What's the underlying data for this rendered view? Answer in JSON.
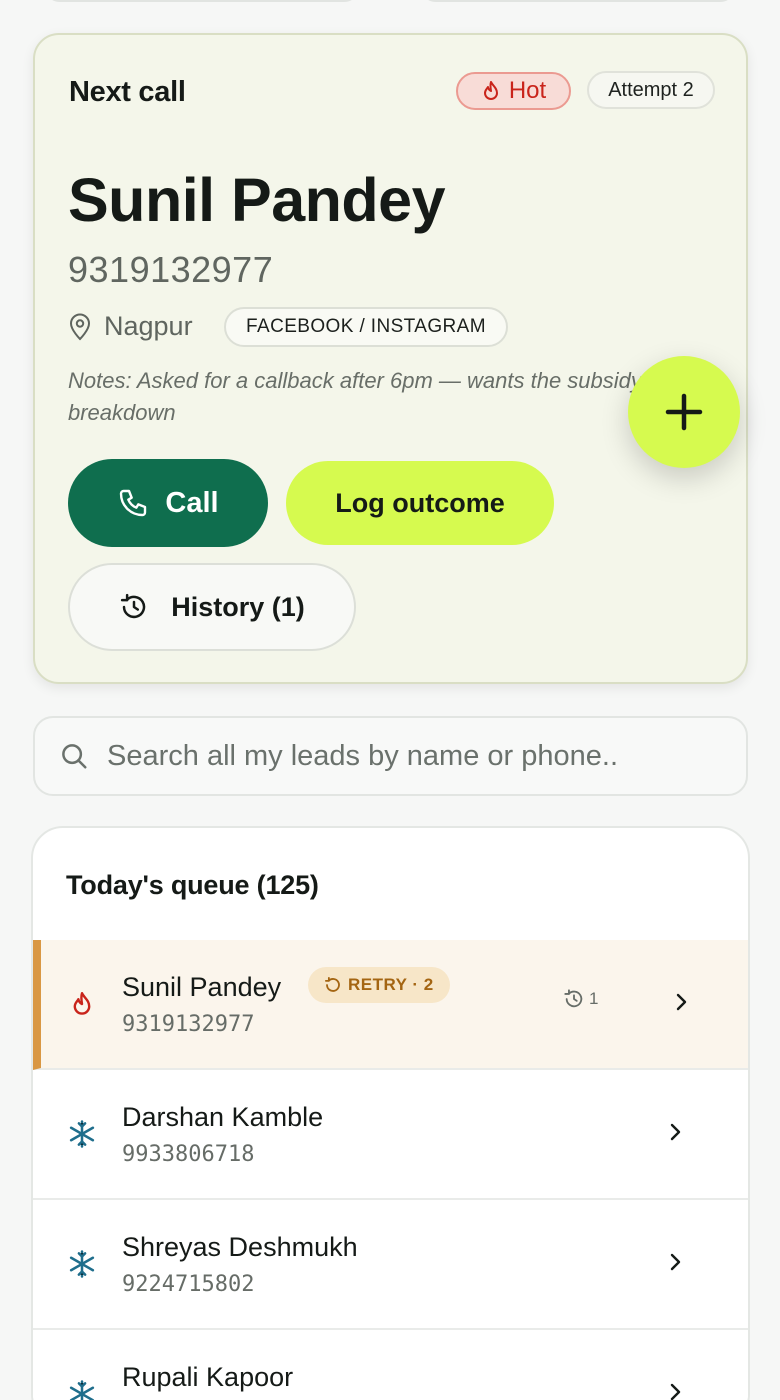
{
  "next_call": {
    "label": "Next call",
    "temperature_badge": "Hot",
    "attempt_badge": "Attempt 2",
    "lead_name": "Sunil Pandey",
    "phone": "9319132977",
    "location": "Nagpur",
    "source": "FACEBOOK / INSTAGRAM",
    "notes": "Notes: Asked for a callback after 6pm — wants the subsidy breakdown",
    "call_label": "Call",
    "log_outcome_label": "Log outcome",
    "history_label": "History (1)"
  },
  "search": {
    "placeholder": "Search all my leads by name or phone.."
  },
  "queue": {
    "title": "Today's queue (125)",
    "rows": [
      {
        "name": "Sunil Pandey",
        "phone": "9319132977",
        "temperature": "hot",
        "retry_badge": "RETRY · 2",
        "history_count": "1",
        "active": true
      },
      {
        "name": "Darshan Kamble",
        "phone": "9933806718",
        "temperature": "cold"
      },
      {
        "name": "Shreyas Deshmukh",
        "phone": "9224715802",
        "temperature": "cold"
      },
      {
        "name": "Rupali Kapoor",
        "phone": "",
        "temperature": "cold"
      }
    ]
  },
  "colors": {
    "primary_green": "#0f6e4e",
    "accent_lime": "#d6fa4f",
    "hot_red": "#c9241b",
    "cold_blue": "#1f6e8c",
    "retry_amber": "#a46512",
    "active_bar": "#d99743"
  },
  "icons": {
    "fab": "plus-icon",
    "call": "phone-icon",
    "history": "history-icon",
    "location": "map-pin-icon",
    "search": "search-icon",
    "hot": "flame-icon",
    "cold": "snowflake-icon",
    "row_action": "chevron-right-icon"
  }
}
